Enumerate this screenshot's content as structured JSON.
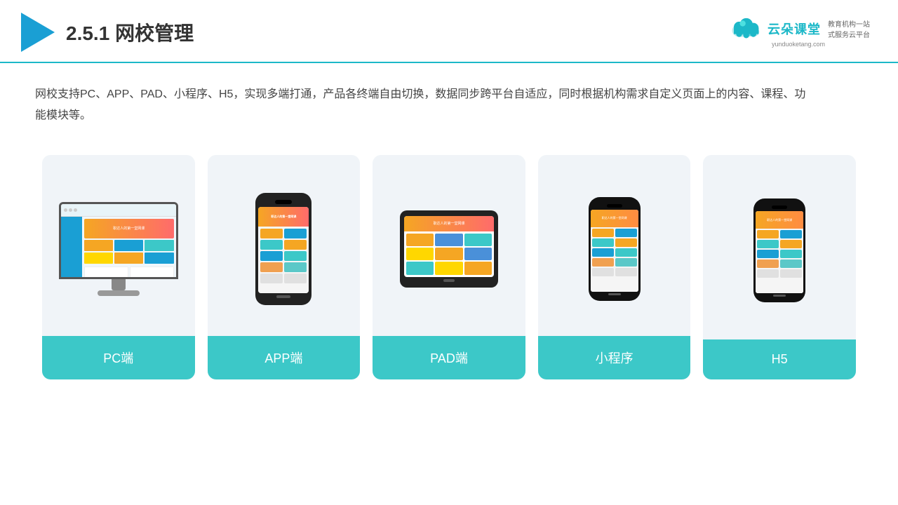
{
  "header": {
    "title": "2.5.1网校管理",
    "title_num": "2.5.1",
    "title_cn": "网校管理"
  },
  "brand": {
    "name": "云朵课堂",
    "tagline_line1": "教育机构一站",
    "tagline_line2": "式服务云平台",
    "url": "yunduoketang.com"
  },
  "description": "网校支持PC、APP、PAD、小程序、H5，实现多端打通，产品各终端自由切换，数据同步跨平台自适应，同时根据机构需求自定义页面上的内容、课程、功能模块等。",
  "cards": [
    {
      "label": "PC端",
      "type": "monitor"
    },
    {
      "label": "APP端",
      "type": "phone"
    },
    {
      "label": "PAD端",
      "type": "tablet"
    },
    {
      "label": "小程序",
      "type": "miniphone"
    },
    {
      "label": "H5",
      "type": "miniphone2"
    }
  ]
}
